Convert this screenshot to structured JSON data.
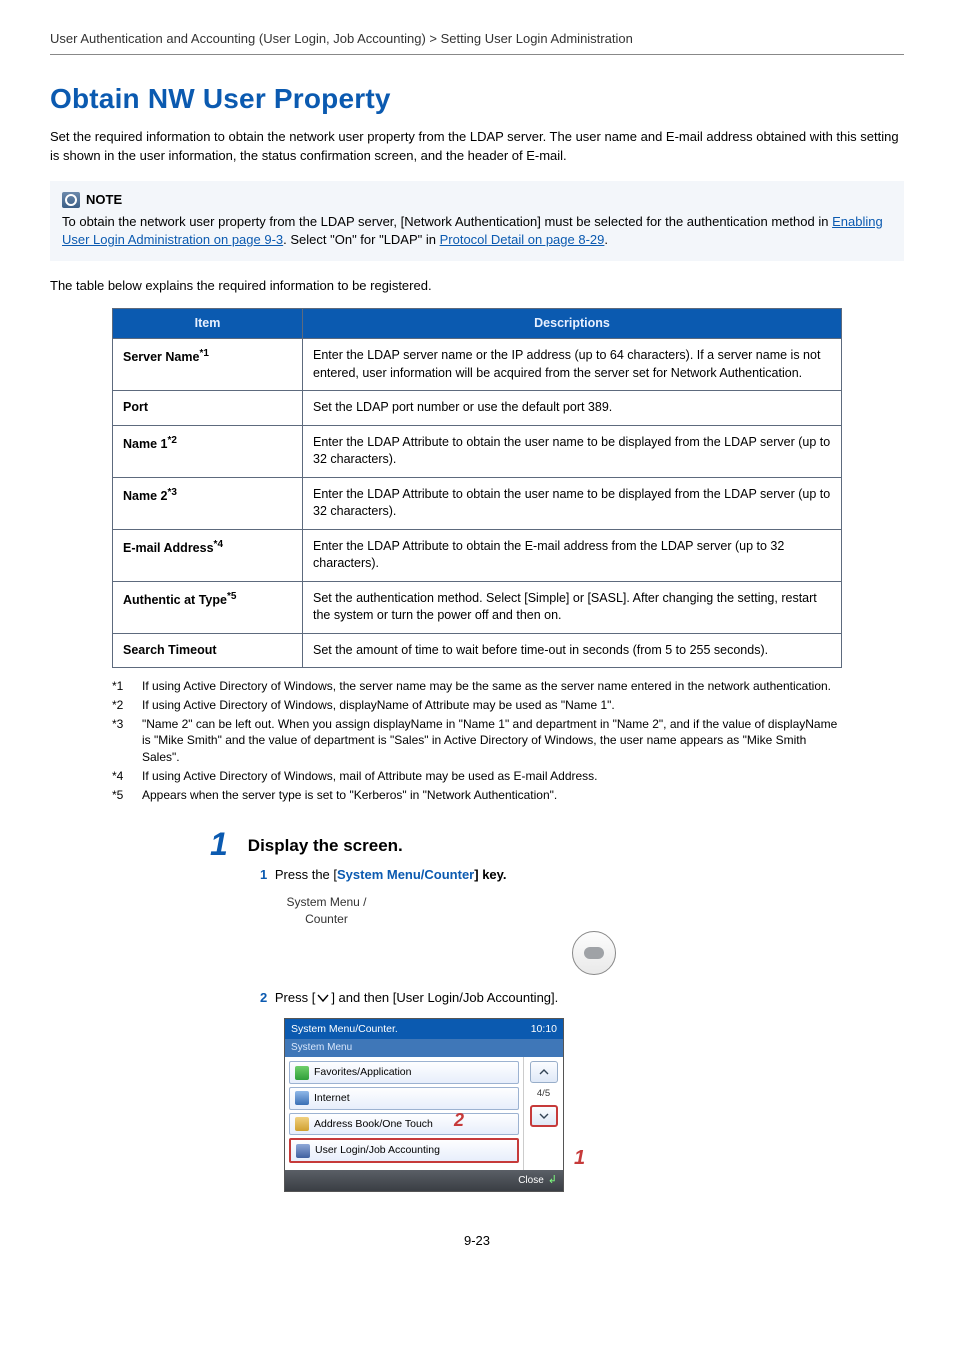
{
  "breadcrumb": "User Authentication and Accounting (User Login, Job Accounting) > Setting User Login Administration",
  "title": "Obtain NW User Property",
  "intro": "Set the required information to obtain the network user property from the LDAP server. The user name and E-mail address obtained with this setting is shown in the user information, the status confirmation screen, and the header of E-mail.",
  "note": {
    "label": "NOTE",
    "body_pre": "To obtain the network user property from the LDAP server, [Network Authentication] must be selected for the authentication method in ",
    "link1": "Enabling User Login Administration on page 9-3",
    "body_mid": ". Select \"On\" for \"LDAP\" in ",
    "link2": "Protocol Detail on page 8-29",
    "body_post": "."
  },
  "pre_table": "The table below explains the required information to be registered.",
  "table": {
    "headers": {
      "item": "Item",
      "desc": "Descriptions"
    },
    "rows": [
      {
        "item": "Server Name",
        "sup": "*1",
        "desc": "Enter the LDAP server name or the IP address (up to 64 characters). If a server name is not entered, user information will be acquired from the server set for Network Authentication."
      },
      {
        "item": "Port",
        "sup": "",
        "desc": "Set the LDAP port number or use the default port 389."
      },
      {
        "item": "Name 1",
        "sup": "*2",
        "desc": "Enter the LDAP Attribute to obtain the user name to be displayed from the LDAP server (up to 32 characters)."
      },
      {
        "item": "Name 2",
        "sup": "*3",
        "desc": "Enter the LDAP Attribute to obtain the user name to be displayed from the LDAP server (up to 32 characters)."
      },
      {
        "item": "E-mail Address",
        "sup": "*4",
        "desc": "Enter the LDAP Attribute to obtain the E-mail address from the LDAP server (up to 32 characters)."
      },
      {
        "item": "Authentic at Type",
        "sup": "*5",
        "desc": "Set the authentication method. Select [Simple] or [SASL]. After changing the setting, restart the system or turn the power off and then on."
      },
      {
        "item": "Search Timeout",
        "sup": "",
        "desc": "Set the amount of time to wait before time-out in seconds (from 5 to 255 seconds)."
      }
    ]
  },
  "footnotes": [
    {
      "tag": "*1",
      "text": "If using Active Directory of Windows, the server name may be the same as the server name entered in the network authentication."
    },
    {
      "tag": "*2",
      "text": "If using Active Directory of Windows, displayName of Attribute may be used as \"Name 1\"."
    },
    {
      "tag": "*3",
      "text": "\"Name 2\" can be left out. When you assign displayName in \"Name 1\" and department in \"Name 2\", and if the value of displayName is \"Mike Smith\" and the value of department is \"Sales\" in Active Directory of Windows, the user name appears as \"Mike Smith Sales\"."
    },
    {
      "tag": "*4",
      "text": "If using Active Directory of Windows, mail of Attribute may be used as E-mail Address."
    },
    {
      "tag": "*5",
      "text": "Appears when the server type is set to \"Kerberos\" in \"Network Authentication\"."
    }
  ],
  "step": {
    "num": "1",
    "title": "Display the screen.",
    "sub1": {
      "num": "1",
      "pre": "Press the [",
      "kbd": "System Menu/Counter",
      "post": "] key."
    },
    "keycap_label1": "System Menu /",
    "keycap_label2": "Counter",
    "sub2": {
      "num": "2",
      "pre": "Press [",
      "post": "] and then [User Login/Job Accounting]."
    }
  },
  "screen": {
    "title": "System Menu/Counter.",
    "time": "10:10",
    "subbar": "System Menu",
    "rows": [
      {
        "label": "Favorites/Application",
        "ic": "ic-fav"
      },
      {
        "label": "Internet",
        "ic": "ic-net"
      },
      {
        "label": "Address Book/One Touch",
        "ic": "ic-addr"
      },
      {
        "label": "User Login/Job Accounting",
        "ic": "ic-user",
        "selected": true
      }
    ],
    "page": "4/5",
    "close": "Close",
    "callout2": "2",
    "callout1": "1"
  },
  "pagenum": "9-23"
}
